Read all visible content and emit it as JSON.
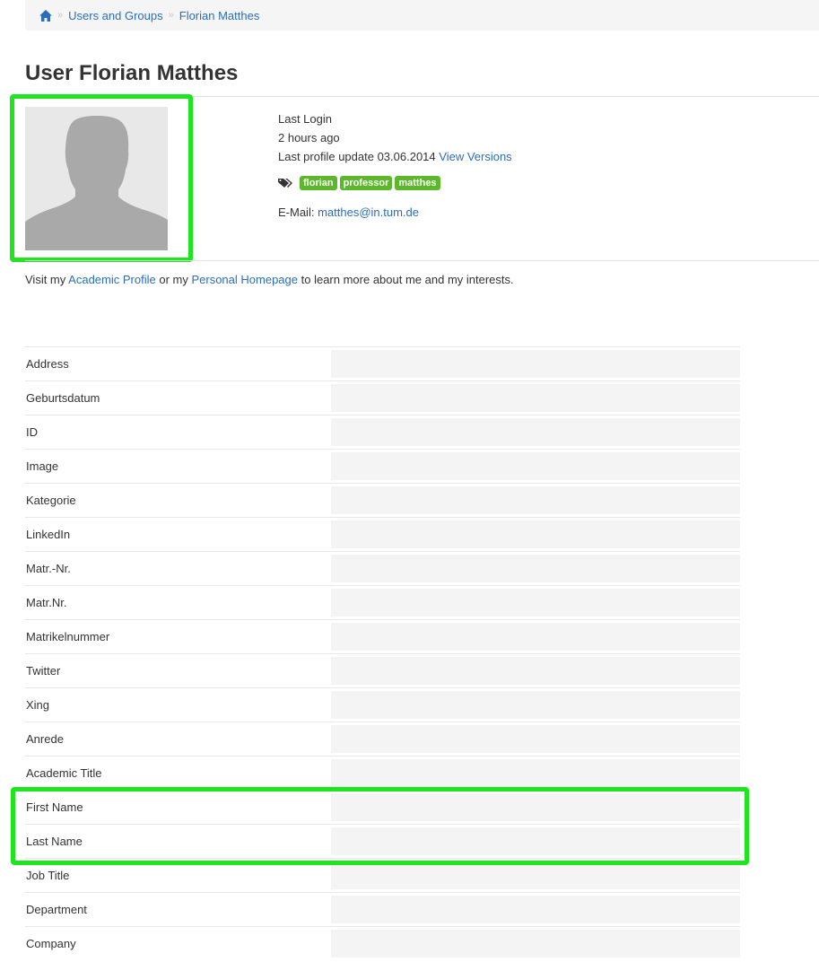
{
  "breadcrumb": {
    "home_icon": "home-icon",
    "items": [
      "Users and Groups",
      "Florian Matthes"
    ]
  },
  "page_title": "User Florian Matthes",
  "profile": {
    "last_login_label": "Last Login",
    "last_login_value": "2 hours ago",
    "last_update_text": "Last profile update 03.06.2014",
    "view_versions_link": "View Versions",
    "tags_icon": "tags-icon",
    "tags": [
      "florian",
      "professor",
      "matthes"
    ],
    "email_label": "E-Mail:",
    "email": "matthes@in.tum.de"
  },
  "intro": {
    "part1": "Visit my",
    "academic_profile_link": "Academic Profile",
    "part2": "or my",
    "personal_homepage_link": "Personal Homepage",
    "part3": "to learn more about me and my interests."
  },
  "properties": [
    "Address",
    "Geburtsdatum",
    "ID",
    "Image",
    "Kategorie",
    "LinkedIn",
    "Matr.-Nr.",
    "Matr.Nr.",
    "Matrikelnummer",
    "Twitter",
    "Xing",
    "Anrede",
    "Academic Title",
    "First Name",
    "Last Name",
    "Job Title",
    "Department",
    "Company"
  ],
  "colors": {
    "link": "#2a6ebb",
    "tag": "#5cb82a",
    "highlight": "#1fe51f"
  }
}
